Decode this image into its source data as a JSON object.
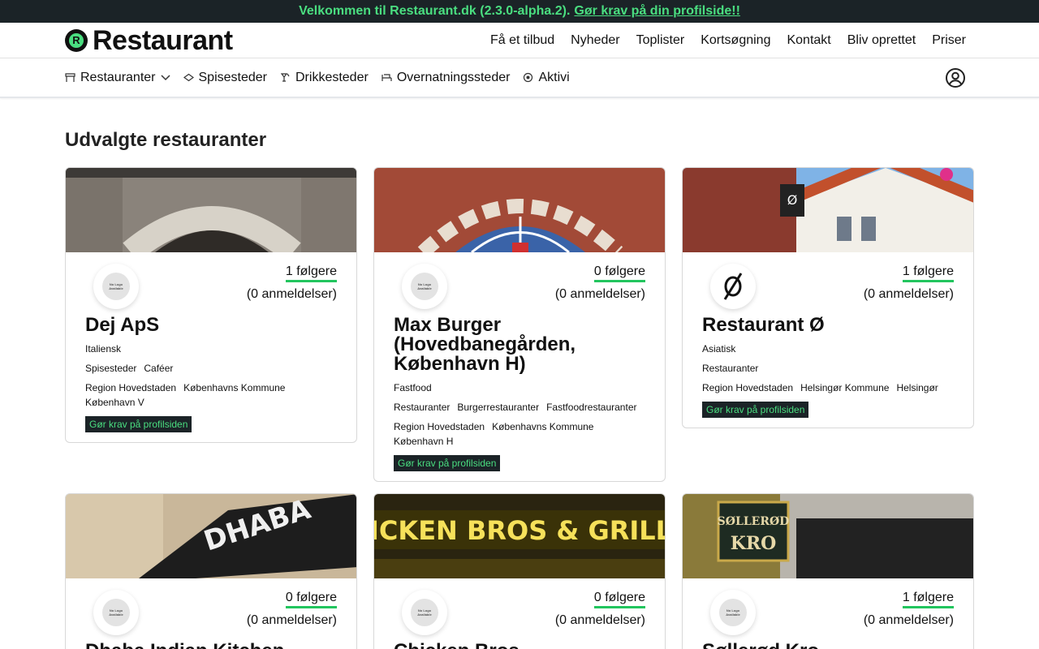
{
  "banner": {
    "text": "Velkommen til Restaurant.dk (2.3.0-alpha.2).",
    "link": "Gør krav på din profilside!!"
  },
  "header": {
    "logo_text": "Restaurant",
    "logo_letter": "R",
    "nav": [
      "Få et tilbud",
      "Nyheder",
      "Toplister",
      "Kortsøgning",
      "Kontakt",
      "Bliv oprettet",
      "Priser"
    ]
  },
  "catnav": {
    "items": [
      {
        "label": "Restauranter",
        "icon": "restaurant-icon",
        "dropdown": true
      },
      {
        "label": "Spisesteder",
        "icon": "food-icon"
      },
      {
        "label": "Drikkesteder",
        "icon": "drink-icon"
      },
      {
        "label": "Overnatningssteder",
        "icon": "bed-icon"
      },
      {
        "label": "Aktivi",
        "icon": "activity-icon"
      }
    ]
  },
  "section_title": "Udvalgte restauranter",
  "nologo_text": "No Logo Available",
  "claim_label": "Gør krav på profilsiden",
  "cards": [
    {
      "followers": "1 følgere",
      "reviews": "(0 anmeldelser)",
      "name": "Dej ApS",
      "tags": [
        [
          "Italiensk"
        ],
        [
          "Spisesteder",
          "Caféer"
        ],
        [
          "Region Hovedstaden",
          "Københavns Kommune",
          "København V"
        ]
      ],
      "claim": true
    },
    {
      "followers": "0 følgere",
      "reviews": "(0 anmeldelser)",
      "name": "Max Burger (Hovedbanegården, København H)",
      "tags": [
        [
          "Fastfood"
        ],
        [
          "Restauranter",
          "Burgerrestauranter",
          "Fastfoodrestauranter"
        ],
        [
          "Region Hovedstaden",
          "Københavns Kommune",
          "København H"
        ]
      ],
      "claim": true
    },
    {
      "followers": "1 følgere",
      "reviews": "(0 anmeldelser)",
      "name": "Restaurant Ø",
      "tags": [
        [
          "Asiatisk"
        ],
        [
          "Restauranter"
        ],
        [
          "Region Hovedstaden",
          "Helsingør Kommune",
          "Helsingør"
        ]
      ],
      "claim": true
    },
    {
      "followers": "0 følgere",
      "reviews": "(0 anmeldelser)",
      "name": "Dhaba Indian Kitchen",
      "tags": [],
      "claim": false
    },
    {
      "followers": "0 følgere",
      "reviews": "(0 anmeldelser)",
      "name": "Chicken Bros",
      "tags": [],
      "claim": false
    },
    {
      "followers": "1 følgere",
      "reviews": "(0 anmeldelser)",
      "name": "Søllerød Kro",
      "tags": [],
      "claim": false
    }
  ],
  "image_signs": {
    "card3_sign": "Ø",
    "card4_sign": "DHABA",
    "card5_sign": "ICKEN BROS & GRILL",
    "card6_sign_top": "SØLLERØD",
    "card6_sign_bottom": "KRO"
  },
  "colors": {
    "accent": "#4ade80",
    "dark": "#1b2327",
    "underline": "#22c55e"
  }
}
